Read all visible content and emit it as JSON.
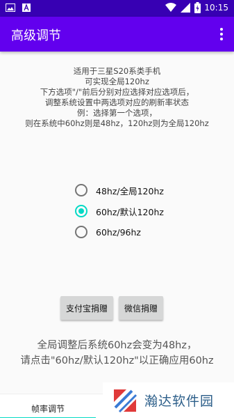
{
  "status_bar": {
    "time": "10:15",
    "left_icons": [
      "image-icon",
      "font-icon"
    ],
    "right_icons": [
      "wifi-icon",
      "signal-icon",
      "battery-icon"
    ]
  },
  "app_bar": {
    "title": "高级调节",
    "menu_icon": "more-vert-icon",
    "background": "#6200ee"
  },
  "description": {
    "lines": [
      "适用于三星S20系类手机",
      "可实现全局120hz",
      "下方选项\"/\"前后分别对应选择对应选项后，",
      "调整系统设置中两选项对应的刷新率状态",
      "例：选择第一个选项，",
      "则在系统中60hz则是48hz，120hz则为全局120hz"
    ]
  },
  "options": [
    {
      "label": "48hz/全局120hz",
      "checked": false
    },
    {
      "label": "60hz/默认120hz",
      "checked": true
    },
    {
      "label": "60hz/96hz",
      "checked": false
    }
  ],
  "buttons": {
    "alipay": "支付宝捐赠",
    "wechat": "微信捐赠"
  },
  "notice": {
    "lines": [
      "全局调整后系统60hz会变为48hz，",
      "请点击\"60hz/默认120hz\"以正确应用60hz"
    ]
  },
  "bottom_nav": {
    "active_tab": "帧率调节"
  },
  "watermark": {
    "text": "瀚达软件园"
  },
  "colors": {
    "accent": "#03dac5",
    "status_bar": "#3700b3",
    "primary": "#6200ee"
  }
}
